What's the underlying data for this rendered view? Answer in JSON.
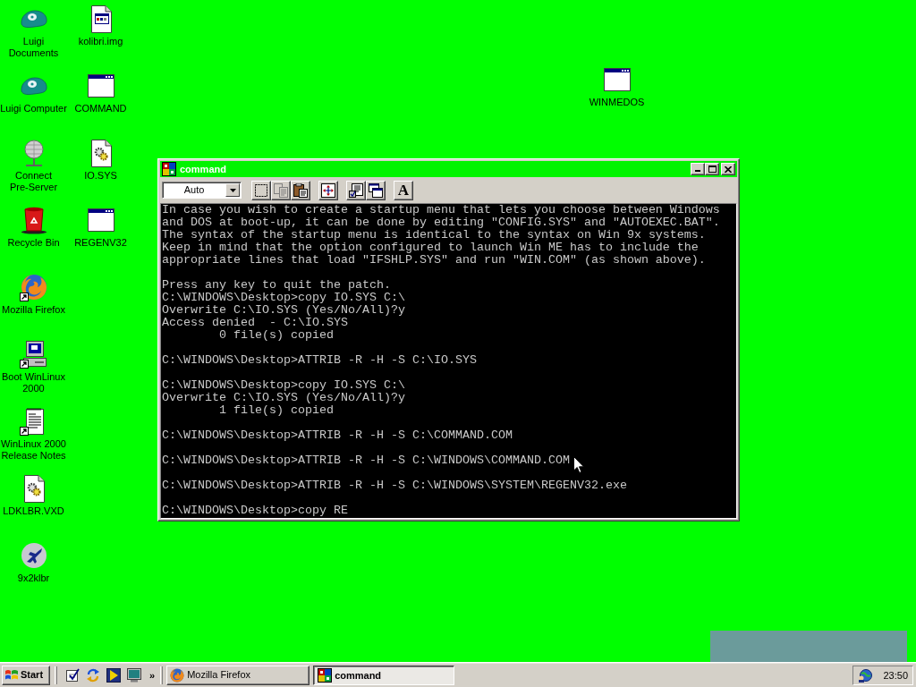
{
  "desktop": {
    "columns": [
      [
        {
          "kind": "cap",
          "shortcut": false,
          "label_lines": [
            "Luigi",
            "Documents"
          ]
        },
        {
          "kind": "cap",
          "shortcut": false,
          "label_lines": [
            "Luigi Computer"
          ]
        },
        {
          "kind": "globe_stand",
          "shortcut": false,
          "label_lines": [
            "Connect",
            "Pre-Server"
          ]
        },
        {
          "kind": "recycle_bin",
          "shortcut": false,
          "label_lines": [
            "Recycle Bin"
          ]
        },
        {
          "kind": "browser",
          "shortcut": true,
          "label_lines": [
            "Mozilla Firefox"
          ]
        },
        {
          "kind": "computer",
          "shortcut": true,
          "label_lines": [
            "Boot WinLinux",
            "2000"
          ]
        },
        {
          "kind": "notepad",
          "shortcut": true,
          "label_lines": [
            "WinLinux 2000",
            "Release Notes"
          ]
        },
        {
          "kind": "gear_file",
          "shortcut": false,
          "label_lines": [
            "LDKLBR.VXD"
          ]
        },
        {
          "kind": "airplane",
          "shortcut": false,
          "label_lines": [
            "9x2klbr"
          ]
        }
      ],
      [
        {
          "kind": "image_file",
          "shortcut": false,
          "label_lines": [
            "kolibri.img"
          ]
        },
        {
          "kind": "program",
          "shortcut": false,
          "label_lines": [
            "COMMAND"
          ]
        },
        {
          "kind": "gear_file",
          "shortcut": false,
          "label_lines": [
            "IO.SYS"
          ]
        },
        {
          "kind": "program",
          "shortcut": false,
          "label_lines": [
            "REGENV32"
          ]
        }
      ]
    ],
    "free_icons": [
      {
        "kind": "program",
        "shortcut": false,
        "label_lines": [
          "WINMEDOS"
        ]
      }
    ]
  },
  "window": {
    "title": "command",
    "toolbar": {
      "font_size": "Auto",
      "groups": [
        [
          {
            "kind": "mark",
            "disabled": false
          },
          {
            "kind": "copy",
            "disabled": true
          },
          {
            "kind": "paste",
            "disabled": false
          }
        ],
        [
          {
            "kind": "fullscreen",
            "disabled": false
          }
        ],
        [
          {
            "kind": "properties",
            "disabled": false
          },
          {
            "kind": "background",
            "disabled": false
          }
        ],
        [
          {
            "kind": "font",
            "label": "A",
            "disabled": false
          }
        ]
      ]
    },
    "console": {
      "blocks": [
        [
          "In case you wish to create a startup menu that lets you choose between Windows",
          "and DOS at boot-up, it can be done by editing \"CONFIG.SYS\" and \"AUTOEXEC.BAT\".",
          "The syntax of the startup menu is identical to the syntax on Win 9x systems.",
          "Keep in mind that the option configured to launch Win ME has to include the",
          "appropriate lines that load \"IFSHLP.SYS\" and run \"WIN.COM\" (as shown above)."
        ],
        [
          "Press any key to quit the patch.",
          "C:\\WINDOWS\\Desktop>copy IO.SYS C:\\",
          "Overwrite C:\\IO.SYS (Yes/No/All)?y",
          "Access denied  - C:\\IO.SYS",
          "        0 file(s) copied"
        ],
        [
          "C:\\WINDOWS\\Desktop>ATTRIB -R -H -S C:\\IO.SYS"
        ],
        [
          "C:\\WINDOWS\\Desktop>copy IO.SYS C:\\",
          "Overwrite C:\\IO.SYS (Yes/No/All)?y",
          "        1 file(s) copied"
        ],
        [
          "C:\\WINDOWS\\Desktop>ATTRIB -R -H -S C:\\COMMAND.COM"
        ],
        [
          "C:\\WINDOWS\\Desktop>ATTRIB -R -H -S C:\\WINDOWS\\COMMAND.COM"
        ],
        [
          "C:\\WINDOWS\\Desktop>ATTRIB -R -H -S C:\\WINDOWS\\SYSTEM\\REGENV32.exe"
        ],
        [
          "C:\\WINDOWS\\Desktop>copy RE"
        ]
      ]
    }
  },
  "taskbar": {
    "start": "Start",
    "quick_launch": [
      {
        "kind": "checklist"
      },
      {
        "kind": "sync"
      },
      {
        "kind": "play"
      },
      {
        "kind": "monitor"
      }
    ],
    "more": "»",
    "tasks": [
      {
        "kind": "browser",
        "label": "Mozilla Firefox",
        "selected": false
      },
      {
        "kind": "msdos",
        "label": "command",
        "selected": true
      }
    ],
    "tray": {
      "icons": [
        {
          "kind": "network"
        }
      ],
      "clock": "23:50"
    }
  }
}
